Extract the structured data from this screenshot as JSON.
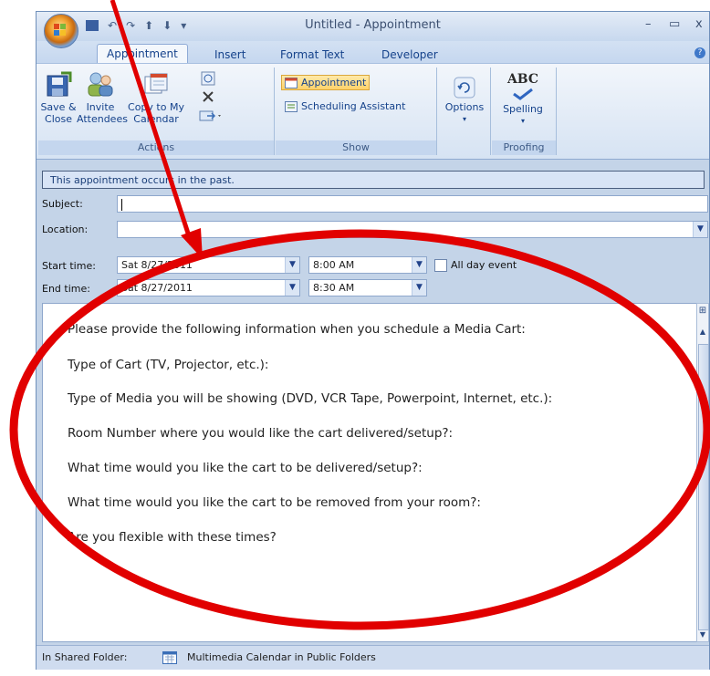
{
  "window": {
    "title": "Untitled - Appointment",
    "controls": {
      "minimize": "–",
      "maximize": "▭",
      "close": "x"
    }
  },
  "qat": {
    "undo": "↶",
    "redo": "↷",
    "prev": "⬆",
    "next": "⬇",
    "more": "▾"
  },
  "tabs": [
    "Appointment",
    "Insert",
    "Format Text",
    "Developer"
  ],
  "ribbon": {
    "actions": {
      "label": "Actions",
      "save_close_line1": "Save &",
      "save_close_line2": "Close",
      "invite_line1": "Invite",
      "invite_line2": "Attendees",
      "copy_line1": "Copy to My",
      "copy_line2": "Calendar"
    },
    "show": {
      "label": "Show",
      "appointment": "Appointment",
      "scheduling": "Scheduling Assistant"
    },
    "options": {
      "label": "Options"
    },
    "proofing": {
      "label": "Proofing",
      "spelling": "Spelling",
      "abc": "ABC"
    }
  },
  "infobar": "This appointment occurs in the past.",
  "form": {
    "subject_label": "Subject:",
    "location_label": "Location:",
    "start_label": "Start time:",
    "end_label": "End time:",
    "start_date": "Sat 8/27/2011",
    "start_time": "8:00 AM",
    "end_date": "Sat 8/27/2011",
    "end_time": "8:30 AM",
    "all_day": "All day event"
  },
  "body_lines": [
    "Please provide the following information when you schedule a Media Cart:",
    "Type of Cart (TV, Projector, etc.):",
    "Type of Media you will be showing (DVD, VCR Tape, Powerpoint, Internet, etc.):",
    "Room Number where you would like the cart delivered/setup?:",
    "What time would you like the cart to be delivered/setup?:",
    "What time would you like the cart to be removed from your room?:",
    "Are you flexible with these times?"
  ],
  "status": {
    "label": "In Shared Folder:",
    "folder": "Multimedia Calendar in Public Folders"
  },
  "colors": {
    "annotation": "#e10000",
    "ribbon_bg": "#d6e3f3",
    "accent": "#15428b"
  }
}
